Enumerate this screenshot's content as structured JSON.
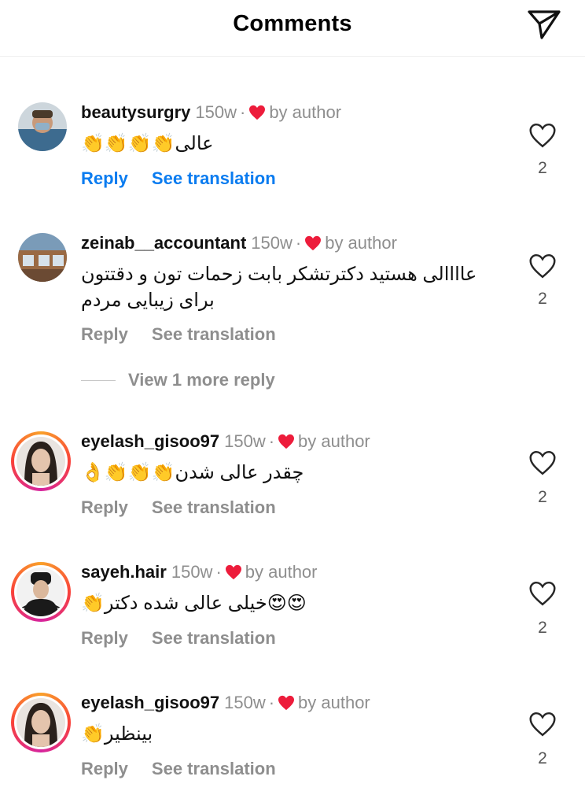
{
  "header": {
    "title": "Comments"
  },
  "comments": [
    {
      "username": "beautysurgry",
      "time": "150w",
      "by_author": "by author",
      "text": "عالی👏👏👏👏",
      "reply": "Reply",
      "see_translation": "See translation",
      "likes": "2",
      "avatar_color": "#6b7f8e",
      "links_blue": true
    },
    {
      "username": "zeinab__accountant",
      "time": "150w",
      "by_author": "by author",
      "text": "عاااالی هستید دکترتشکر بابت زحمات تون و دقتتون برای زیبایی مردم",
      "reply": "Reply",
      "see_translation": "See translation",
      "likes": "2",
      "avatar_color": "#a0683a",
      "links_blue": false
    },
    {
      "username": "eyelash_gisoo97",
      "time": "150w",
      "by_author": "by author",
      "text": "چقدر عالی شدن👏👏👏👌",
      "reply": "Reply",
      "see_translation": "See translation",
      "likes": "2",
      "avatar_color": "#d9c3b0",
      "links_blue": false
    },
    {
      "username": "sayeh.hair",
      "time": "150w",
      "by_author": "by author",
      "text": "😍😍خیلی عالی شده دکتر👏",
      "reply": "Reply",
      "see_translation": "See translation",
      "likes": "2",
      "avatar_color": "#2b2b2b",
      "links_blue": false
    },
    {
      "username": "eyelash_gisoo97",
      "time": "150w",
      "by_author": "by author",
      "text": "بینظیر👏",
      "reply": "Reply",
      "see_translation": "See translation",
      "likes": "2",
      "avatar_color": "#d9c3b0",
      "links_blue": false
    }
  ],
  "view_more_replies": "View 1 more reply",
  "colors": {
    "link_blue": "#0a7cf0",
    "muted": "#8e8e8e",
    "heart_red": "#ed1c3b"
  }
}
